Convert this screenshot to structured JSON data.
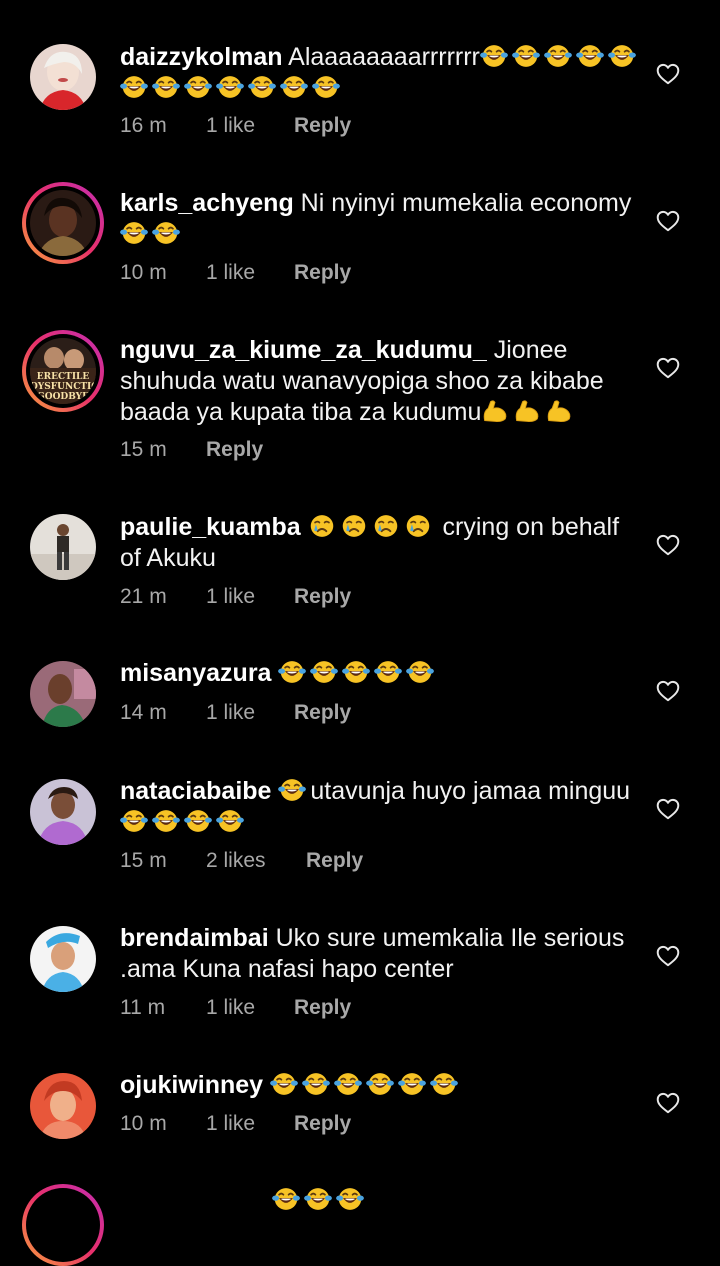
{
  "comments": [
    {
      "username": "daizzykolman",
      "text": "Alaaaaaaaarrrrrrr",
      "emoji_after": [
        "laughing-tears",
        "laughing-tears",
        "laughing-tears",
        "laughing-tears",
        "laughing-tears",
        "laughing-tears",
        "laughing-tears",
        "laughing-tears",
        "laughing-tears",
        "laughing-tears",
        "laughing-tears",
        "laughing-tears"
      ],
      "time": "16 m",
      "likes": "1 like",
      "reply_label": "Reply"
    },
    {
      "username": "karls_achyeng",
      "text": "Ni nyinyi mumekalia economy",
      "emoji_after": [
        "laughing-tears",
        "laughing-tears"
      ],
      "time": "10 m",
      "likes": "1 like",
      "reply_label": "Reply"
    },
    {
      "username": "nguvu_za_kiume_za_kudumu_",
      "text": "Jionee shuhuda watu wanavyopiga shoo za kibabe baada ya kupata tiba za kudumu",
      "emoji_after": [
        "flexed-biceps",
        "flexed-biceps",
        "flexed-biceps"
      ],
      "time": "15 m",
      "likes": "",
      "reply_label": "Reply",
      "avatar_text": [
        "ERECTILE",
        "DYSFUNCTION",
        "GOODBYE"
      ]
    },
    {
      "username": "paulie_kuamba",
      "text_before_emoji": "",
      "emoji_inline": [
        "crying-face",
        "crying-face",
        "crying-face",
        "crying-face"
      ],
      "text": "crying on behalf of Akuku",
      "time": "21 m",
      "likes": "1 like",
      "reply_label": "Reply"
    },
    {
      "username": "misanyazura",
      "text": "",
      "emoji_after": [
        "laughing-tears",
        "laughing-tears",
        "laughing-tears",
        "laughing-tears",
        "laughing-tears"
      ],
      "time": "14 m",
      "likes": "1 like",
      "reply_label": "Reply"
    },
    {
      "username": "nataciabaibe",
      "text": "utavunja huyo jamaa minguu",
      "time": "15 m",
      "likes": "2 likes",
      "reply_label": "Reply"
    },
    {
      "username": "brendaimbai",
      "text": "Uko sure umemkalia Ile serious .ama Kuna nafasi hapo center",
      "time": "11 m",
      "likes": "1 like",
      "reply_label": "Reply"
    },
    {
      "username": "ojukiwinney",
      "text": "",
      "emoji_after": [
        "laughing-tears",
        "laughing-tears",
        "laughing-tears",
        "laughing-tears",
        "laughing-tears",
        "laughing-tears"
      ],
      "time": "10 m",
      "likes": "1 like",
      "reply_label": "Reply"
    }
  ],
  "icons": {
    "like": "heart-outline-icon"
  },
  "colors": {
    "background": "#000000",
    "text": "#f2f2f2",
    "meta": "#a8a8a8",
    "story_ring_start": "#f9a23c",
    "story_ring_end": "#c22db6",
    "emoji_yellow": "#f7c325",
    "tear_blue": "#4aa3df"
  }
}
